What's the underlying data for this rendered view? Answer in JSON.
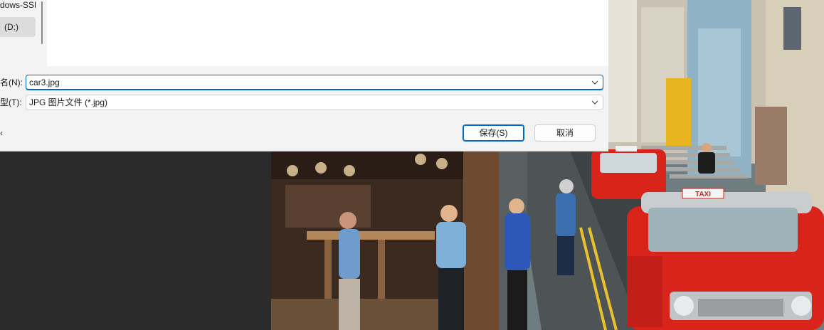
{
  "dialog": {
    "nav_items": [
      {
        "label": "dows-SSD"
      },
      {
        "label": "(D:)"
      }
    ],
    "filename": {
      "label": "名(N):",
      "value": "car3.jpg"
    },
    "filetype": {
      "label": "型(T):",
      "value": "JPG 图片文件 (*.jpg)"
    },
    "edge_text": "‹",
    "save_label": "保存(S)",
    "cancel_label": "取消"
  },
  "photo": {
    "taxi_sign": "TAXI"
  },
  "colors": {
    "accent": "#0067c0",
    "dialog_bg": "#f3f3f3",
    "taxi_red": "#d9241c"
  }
}
